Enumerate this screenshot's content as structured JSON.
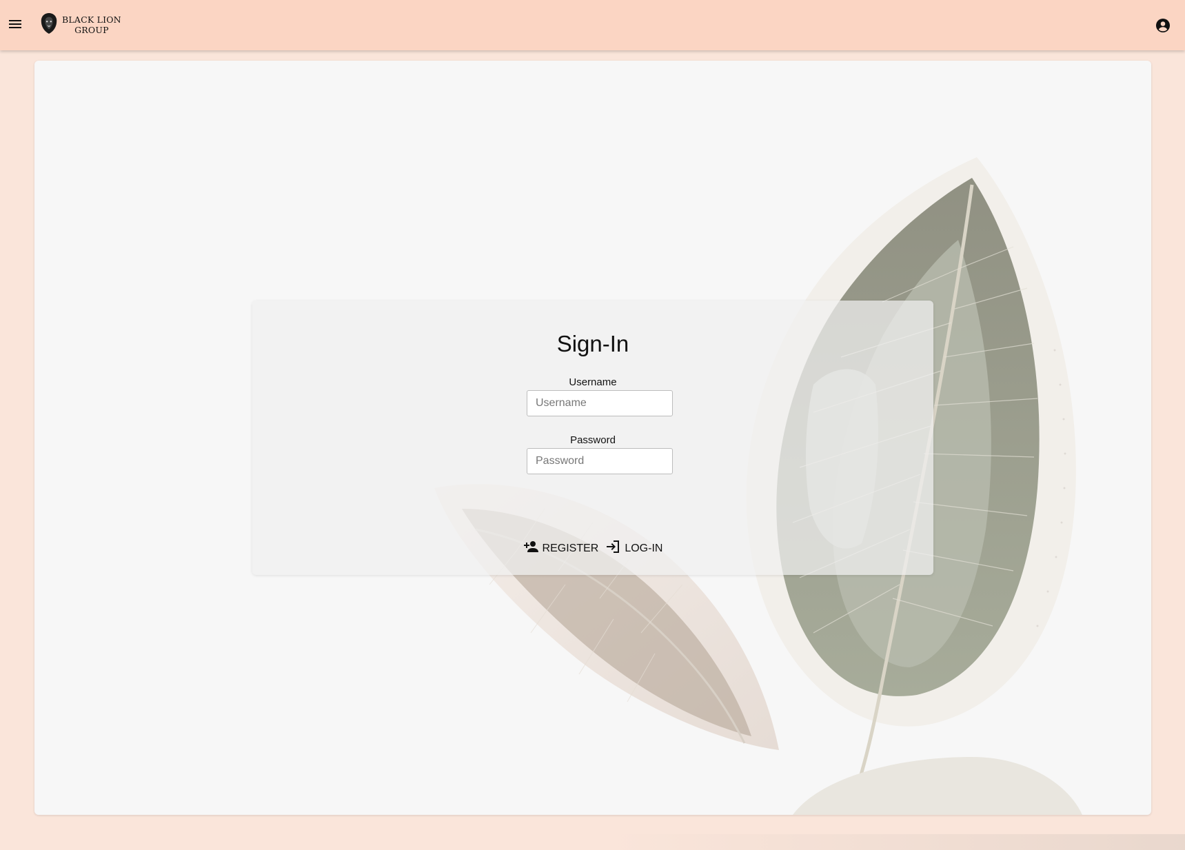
{
  "header": {
    "brand_line1": "BLACK LION",
    "brand_line2": "GROUP",
    "menu_icon": "menu-icon",
    "account_icon": "account-circle-icon"
  },
  "signin": {
    "title": "Sign-In",
    "username_label": "Username",
    "username_placeholder": "Username",
    "username_value": "",
    "password_label": "Password",
    "password_placeholder": "Password",
    "password_value": "",
    "register_label": "REGISTER",
    "login_label": "LOG-IN",
    "register_icon": "person-add-icon",
    "login_icon": "login-icon"
  },
  "colors": {
    "header_bg": "#fbd5c3",
    "page_bg": "#fae5da",
    "panel_bg": "#f7f7f7"
  }
}
